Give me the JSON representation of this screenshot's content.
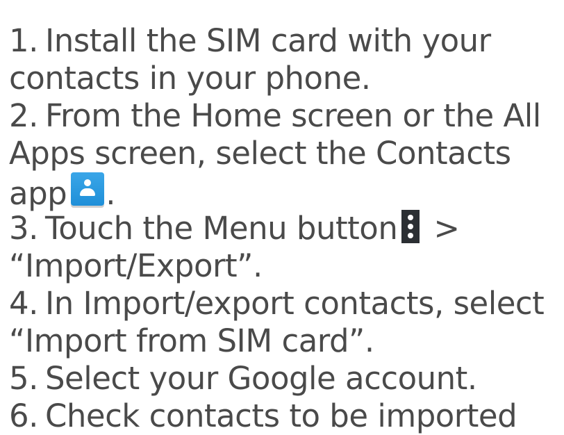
{
  "steps": [
    {
      "num": "1.",
      "lines": [
        "Install the SIM card with your",
        "contacts in your phone."
      ]
    },
    {
      "num": "2.",
      "lines": [
        "From the Home screen or the All",
        "Apps screen, select the Contacts",
        "app"
      ],
      "trailing": "."
    },
    {
      "num": "3.",
      "lines": [
        "Touch the Menu button",
        "“Import/Export”."
      ],
      "separator": ">"
    },
    {
      "num": "4.",
      "lines": [
        "In Import/export contacts, select",
        "“Import from SIM card”."
      ]
    },
    {
      "num": "5.",
      "lines": [
        "Select your Google account."
      ]
    },
    {
      "num": "6.",
      "lines": [
        "Check contacts to be imported"
      ]
    }
  ],
  "icons": {
    "contacts": "contacts-app-icon",
    "menu": "menu-button-icon"
  },
  "colors": {
    "text": "#4a4a4a",
    "contacts_icon": "#2196e0",
    "menu_icon": "#2b2f33"
  }
}
